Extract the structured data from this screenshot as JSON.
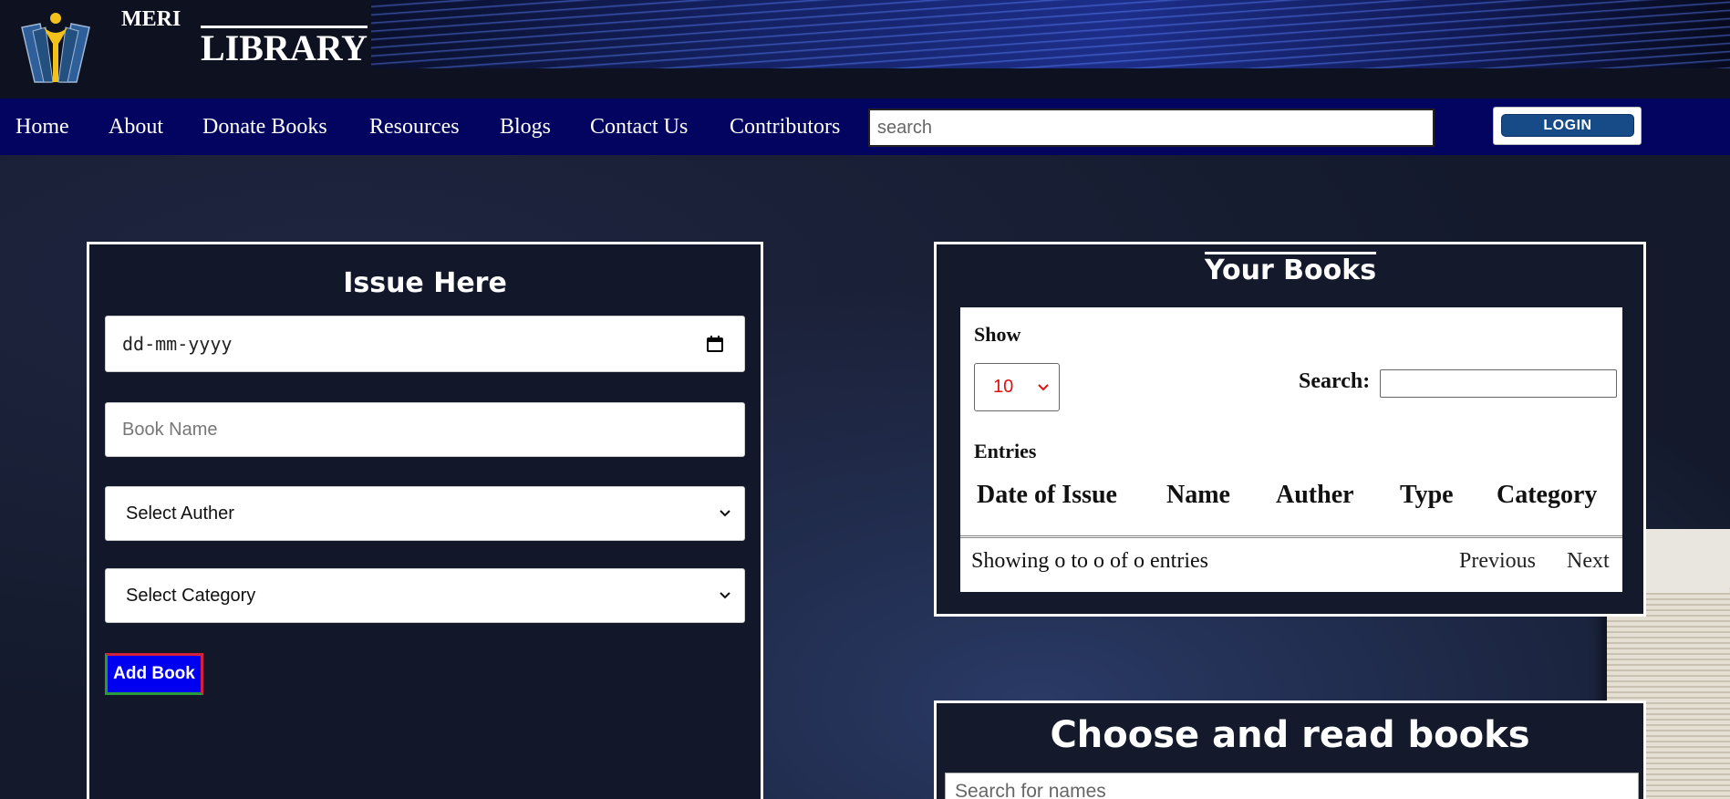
{
  "brand": {
    "top": "MERI",
    "main": "LIBRARY"
  },
  "nav": {
    "items": [
      "Home",
      "About",
      "Donate Books",
      "Resources",
      "Blogs",
      "Contact Us",
      "Contributors"
    ],
    "search_placeholder": "search",
    "login_label": "LOGIN"
  },
  "issue": {
    "title": "Issue Here",
    "date_placeholder": "dd-mm-yyyy",
    "book_name_placeholder": "Book Name",
    "author_select": "Select Auther",
    "category_select": "Select Category",
    "add_button": "Add Book"
  },
  "books": {
    "title": "Your Books",
    "show_label": "Show",
    "length_value": "10",
    "search_label": "Search:",
    "entries_label": "Entries",
    "columns": [
      "Date of Issue",
      "Name",
      "Auther",
      "Type",
      "Category"
    ],
    "info": "Showing o to o of o entries",
    "prev": "Previous",
    "next": "Next"
  },
  "choose": {
    "title": "Choose and read books",
    "search_placeholder": "Search for names"
  },
  "colors": {
    "nav_bg": "#02045f",
    "header_bg": "#0e1120",
    "page_bg": "#141a2c",
    "login_bg": "#164b88",
    "add_button_bg": "#0000f0",
    "length_text": "#e01010"
  }
}
